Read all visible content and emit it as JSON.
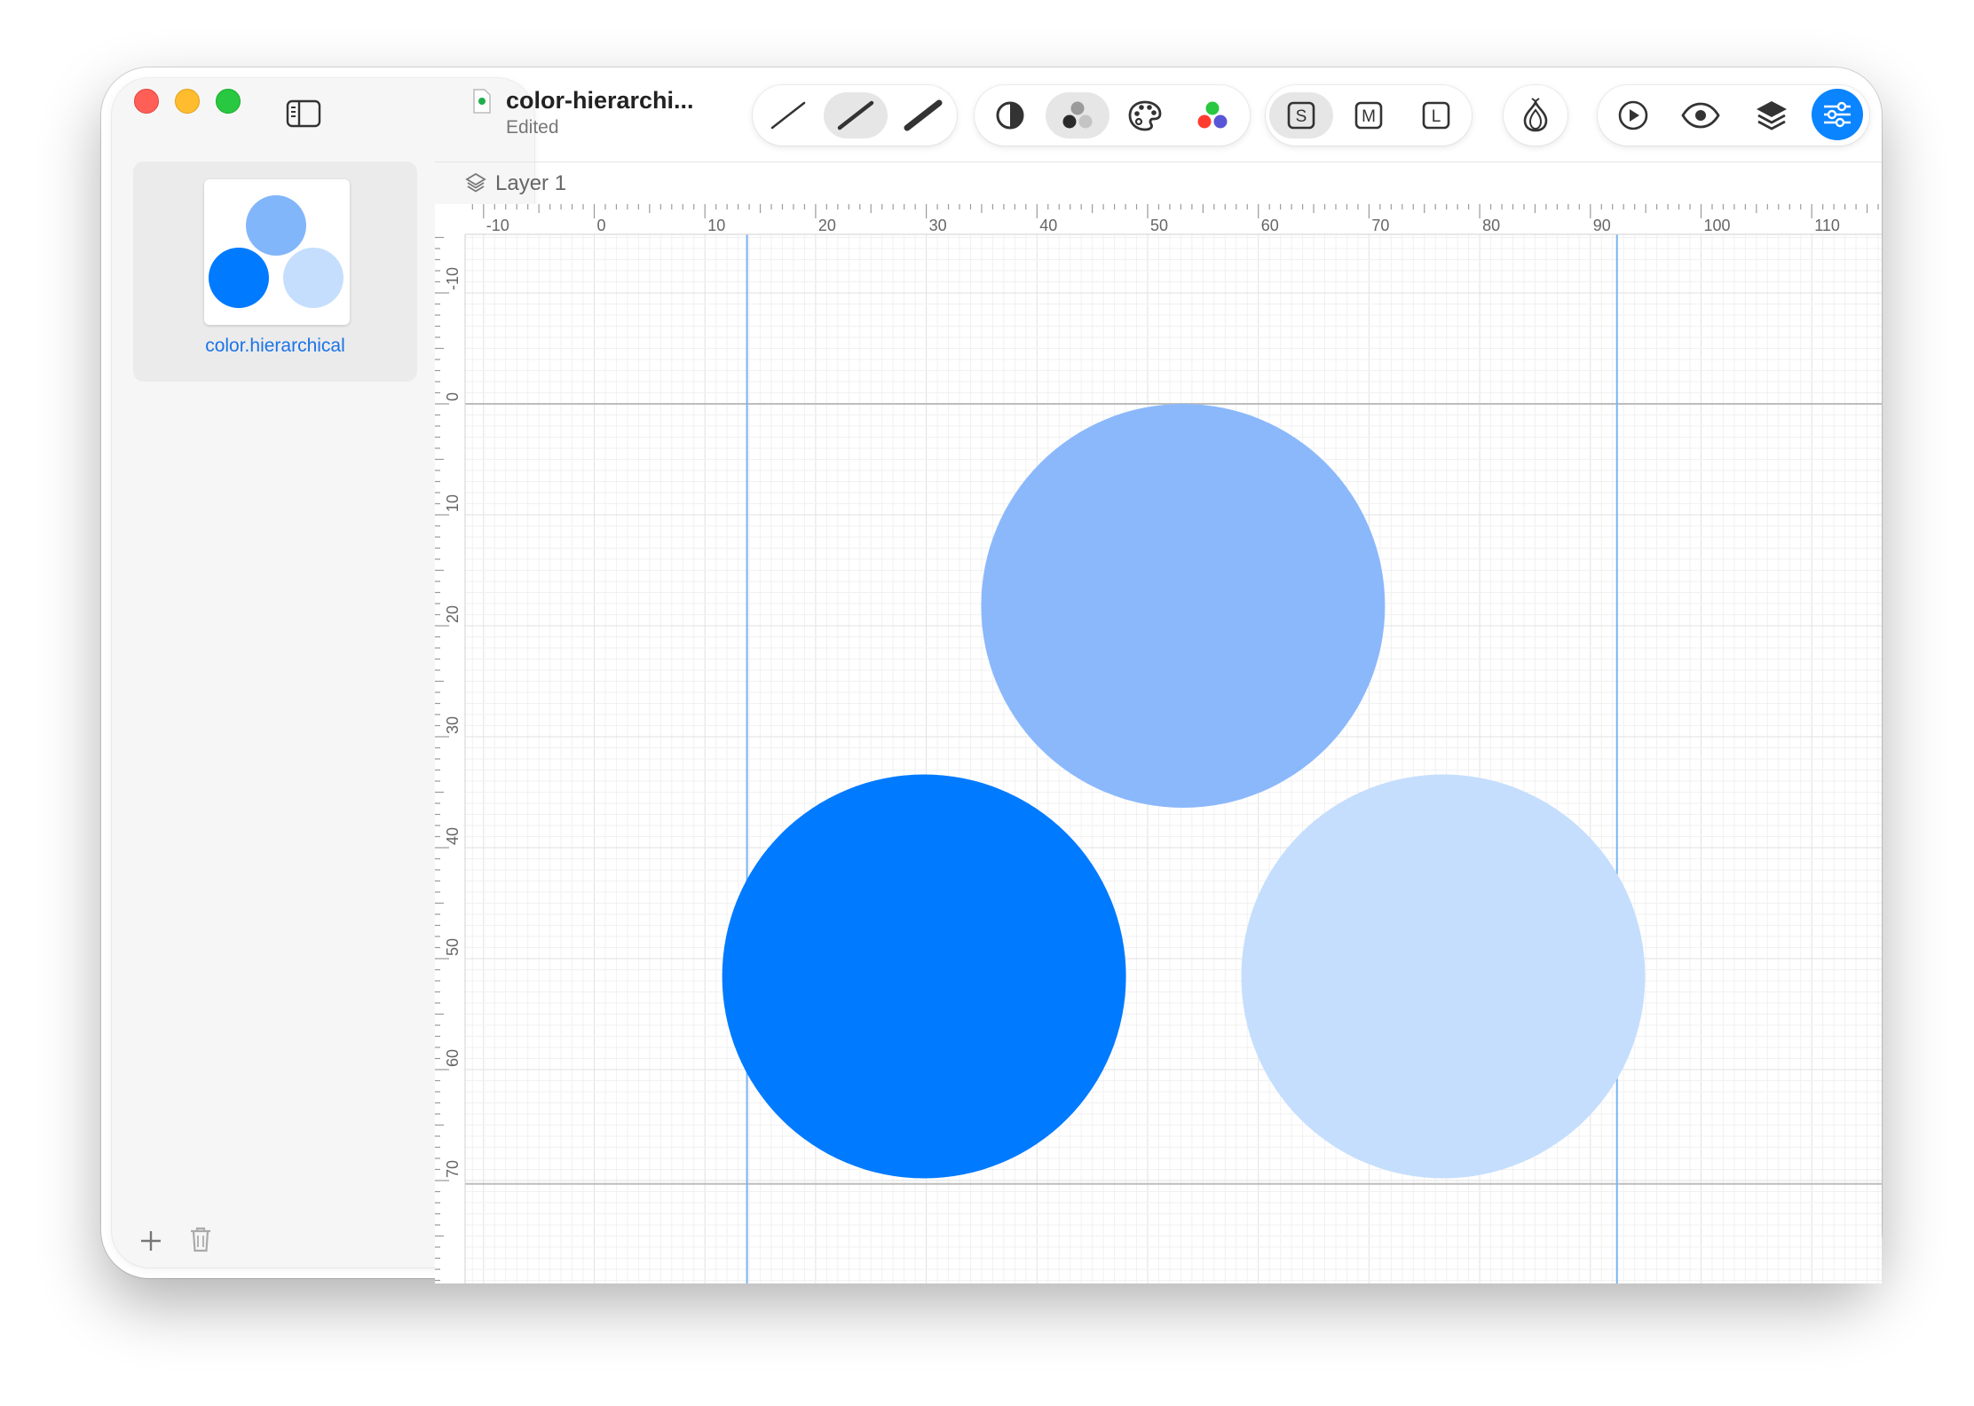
{
  "document": {
    "title": "color-hierarchi...",
    "status": "Edited"
  },
  "sidebar": {
    "symbols": [
      {
        "name": "color.hierarchical"
      }
    ]
  },
  "layer": {
    "name": "Layer 1"
  },
  "rulers": {
    "horizontal_labels": [
      "-10",
      "0",
      "10",
      "20",
      "30",
      "40",
      "50",
      "60",
      "70",
      "80",
      "90",
      "100",
      "110"
    ],
    "vertical_labels": [
      "-10",
      "0",
      "10",
      "20",
      "30",
      "40",
      "50",
      "60",
      "70"
    ]
  },
  "colors": {
    "accent": "#0a84ff",
    "primary_layer": "#007aff",
    "secondary_layer": "#8bb8fb",
    "tertiary_layer": "#c5defd",
    "guide": "#7ab3f0"
  },
  "icons": {
    "toolbar": [
      "thin-weight-icon",
      "regular-weight-icon",
      "bold-weight-icon",
      "monochrome-icon",
      "hierarchical-icon",
      "palette-icon",
      "multicolor-icon",
      "scale-small-icon",
      "scale-medium-icon",
      "scale-large-icon",
      "onion-skin-icon",
      "play-icon",
      "preview-eye-icon",
      "layers-icon",
      "inspector-icon"
    ]
  }
}
